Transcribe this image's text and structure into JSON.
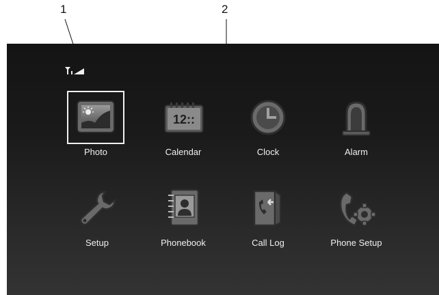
{
  "callouts": [
    "1",
    "2"
  ],
  "status": {
    "signal_icon": "signal-antenna-icon"
  },
  "apps": [
    {
      "label": "Photo",
      "icon": "photo-icon",
      "selected": true
    },
    {
      "label": "Calendar",
      "icon": "calendar-icon",
      "icon_text": "12::"
    },
    {
      "label": "Clock",
      "icon": "clock-icon"
    },
    {
      "label": "Alarm",
      "icon": "alarm-bell-icon"
    },
    {
      "label": "Setup",
      "icon": "wrench-icon"
    },
    {
      "label": "Phonebook",
      "icon": "phonebook-icon"
    },
    {
      "label": "Call Log",
      "icon": "call-log-icon"
    },
    {
      "label": "Phone Setup",
      "icon": "phone-gear-icon"
    }
  ],
  "colors": {
    "screen_bg_top": "#141414",
    "screen_bg_bottom": "#333333",
    "label": "#f0f0f0",
    "selection": "#f2f2f2"
  }
}
